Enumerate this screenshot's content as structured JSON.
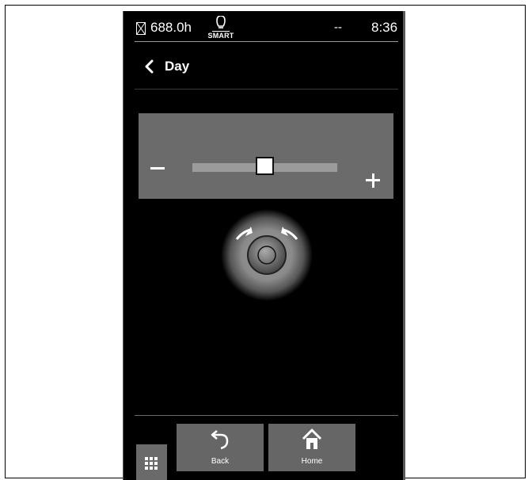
{
  "status_bar": {
    "hours_icon": "hourglass-icon",
    "hours": "688.0h",
    "mode_icon": "smart-bulb-icon",
    "mode_label": "SMART",
    "signal": "--",
    "time": "8:36"
  },
  "header": {
    "back_icon": "chevron-left-icon",
    "title": "Day"
  },
  "slider": {
    "decrease_icon": "minus-icon",
    "increase_icon": "plus-icon",
    "value_fraction": 0.5
  },
  "knob": {
    "icon": "rotary-knob-icon"
  },
  "footer": {
    "menu_icon": "grid-menu-icon",
    "back": {
      "label": "Back",
      "icon": "undo-arrow-icon"
    },
    "home": {
      "label": "Home",
      "icon": "home-icon"
    }
  },
  "colors": {
    "background": "#000000",
    "panel": "#6b6b6b",
    "button": "#666666",
    "text": "#ffffff"
  }
}
